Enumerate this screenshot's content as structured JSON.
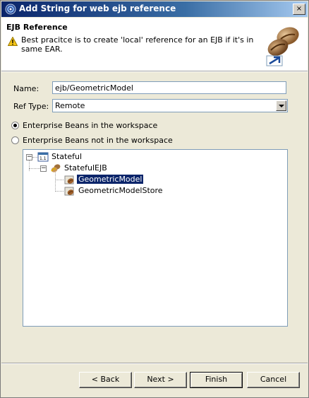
{
  "window": {
    "title": "Add String for web ejb reference",
    "close_glyph": "×"
  },
  "banner": {
    "title": "EJB Reference",
    "message": "Best pracitce is to create 'local' reference for an EJB if it's in same EAR.",
    "warning_icon": "warning-icon",
    "wizard_icon": "ejb-bean-wizard-icon"
  },
  "form": {
    "name_label": "Name:",
    "name_value": "ejb/GeometricModel",
    "ref_type_label": "Ref Type:",
    "ref_type_value": "Remote",
    "radio_in_workspace": "Enterprise Beans in the workspace",
    "radio_not_in_workspace": "Enterprise Beans not in the workspace",
    "radio_selected": "in_workspace"
  },
  "tree": {
    "root": {
      "label": "Stateful",
      "expander": "−"
    },
    "child": {
      "label": "StatefulEJB",
      "expander": "−"
    },
    "leaves": [
      {
        "label": "GeometricModel",
        "selected": true
      },
      {
        "label": "GeometricModelStore",
        "selected": false
      }
    ]
  },
  "buttons": {
    "back": "< Back",
    "next": "Next >",
    "finish": "Finish",
    "cancel": "Cancel"
  },
  "colors": {
    "title_bar": "#0a246a",
    "dialog_bg": "#ece9d8",
    "selection": "#0a246a"
  }
}
